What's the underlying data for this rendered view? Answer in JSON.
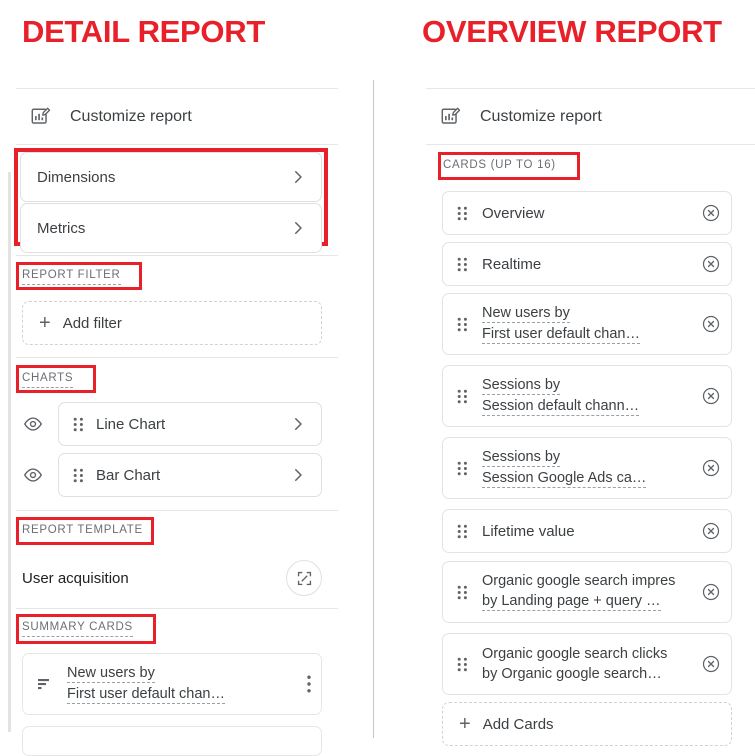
{
  "colors": {
    "annotation_red": "#e8202a",
    "text": "#3c4043",
    "muted": "#6b6f74"
  },
  "annotations": {
    "detail_title": "DETAIL REPORT",
    "overview_title": "OVERVIEW REPORT"
  },
  "detail_panel": {
    "header": {
      "label": "Customize report",
      "icon": "customize-report-icon"
    },
    "settings_items": [
      {
        "label": "Dimensions",
        "chevron": "chevron-right-icon"
      },
      {
        "label": "Metrics",
        "chevron": "chevron-right-icon"
      }
    ],
    "report_filter": {
      "section_label": "REPORT FILTER",
      "add_label": "Add filter",
      "add_icon": "plus-icon"
    },
    "charts": {
      "section_label": "CHARTS",
      "items": [
        {
          "label": "Line Chart",
          "visibility_icon": "eye-icon",
          "drag_icon": "drag-handle-icon",
          "chevron": "chevron-right-icon"
        },
        {
          "label": "Bar Chart",
          "visibility_icon": "eye-icon",
          "drag_icon": "drag-handle-icon",
          "chevron": "chevron-right-icon"
        }
      ]
    },
    "report_template": {
      "section_label": "REPORT TEMPLATE",
      "name": "User acquisition",
      "action_icon": "change-template-icon"
    },
    "summary_cards": {
      "section_label": "SUMMARY CARDS",
      "items": [
        {
          "line1": "New users by",
          "line2": "First user default chan…",
          "icon": "bar-chart-icon",
          "menu_icon": "more-options-icon"
        }
      ]
    }
  },
  "overview_panel": {
    "header": {
      "label": "Customize report",
      "icon": "customize-report-icon"
    },
    "cards_section_label": "CARDS (UP TO 16)",
    "cards": [
      {
        "line1": "Overview",
        "line2": "",
        "lines": 1,
        "remove_icon": "remove-circle-icon",
        "drag_icon": "drag-handle-icon"
      },
      {
        "line1": "Realtime",
        "line2": "",
        "lines": 1,
        "remove_icon": "remove-circle-icon",
        "drag_icon": "drag-handle-icon"
      },
      {
        "line1": "New users by",
        "line2": "First user default chan…",
        "lines": 2,
        "remove_icon": "remove-circle-icon",
        "drag_icon": "drag-handle-icon"
      },
      {
        "line1": "Sessions by",
        "line2": "Session default chann…",
        "lines": 2,
        "remove_icon": "remove-circle-icon",
        "drag_icon": "drag-handle-icon"
      },
      {
        "line1": "Sessions by",
        "line2": "Session Google Ads ca…",
        "lines": 2,
        "remove_icon": "remove-circle-icon",
        "drag_icon": "drag-handle-icon"
      },
      {
        "line1": "Lifetime value",
        "line2": "",
        "lines": 1,
        "remove_icon": "remove-circle-icon",
        "drag_icon": "drag-handle-icon"
      },
      {
        "line1": "Organic google search impres",
        "line2": "by Landing page + query …",
        "lines": 2,
        "remove_icon": "remove-circle-icon",
        "drag_icon": "drag-handle-icon"
      },
      {
        "line1": "Organic google search clicks",
        "line2": "by Organic google search…",
        "lines": 2,
        "remove_icon": "remove-circle-icon",
        "drag_icon": "drag-handle-icon"
      }
    ],
    "add_cards": {
      "label": "Add Cards",
      "icon": "plus-icon"
    }
  }
}
